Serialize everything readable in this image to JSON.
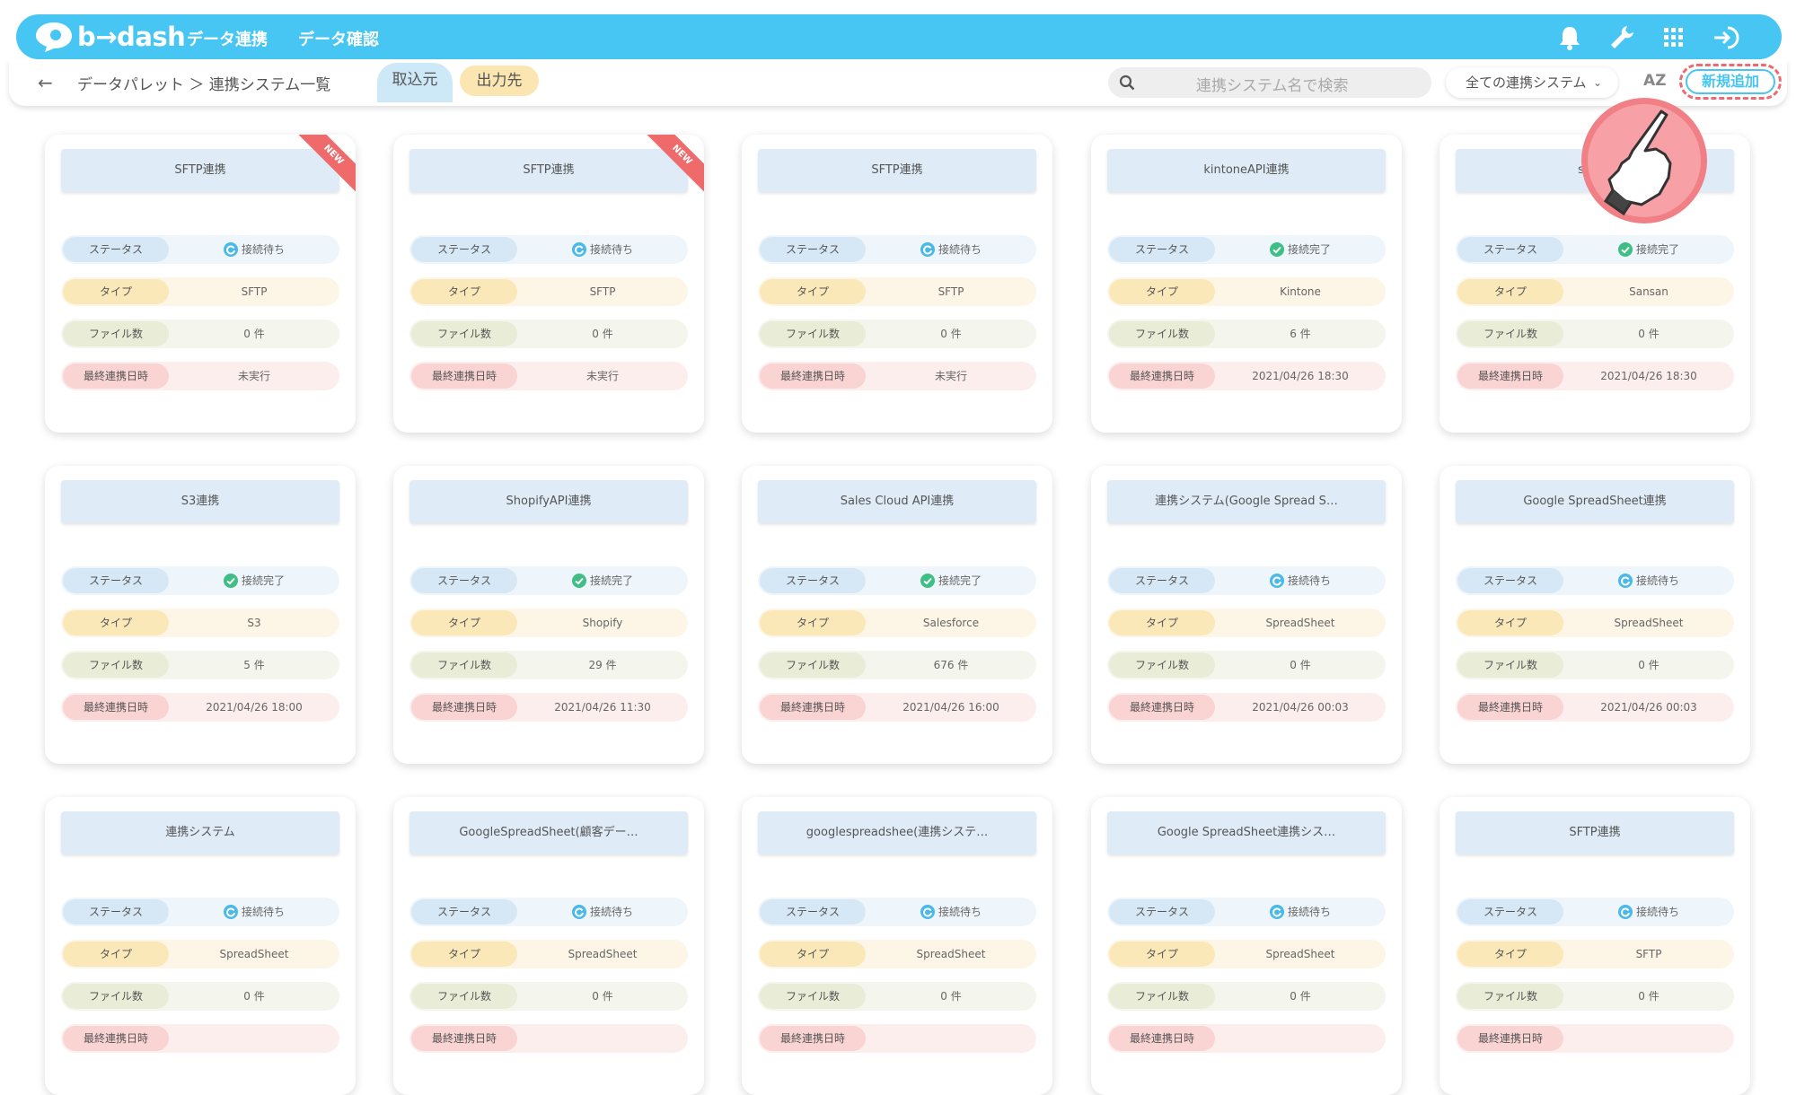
{
  "app": {
    "logo_text": "b→dash"
  },
  "nav": {
    "item1": "データ連携",
    "item2": "データ確認"
  },
  "breadcrumb": "データパレット ＞ 連携システム一覧",
  "tabs": {
    "import": "取込元",
    "export": "出力先"
  },
  "search": {
    "placeholder": "連携システム名で検索"
  },
  "filter": {
    "selected": "全ての連携システム"
  },
  "sort_label": "AZ",
  "new_button": "新規追加",
  "labels": {
    "status": "ステータス",
    "type": "タイプ",
    "files": "ファイル数",
    "last": "最終連携日時"
  },
  "badges": {
    "new": "NEW"
  },
  "colors": {
    "accent": "#48c6f3",
    "waiting": "#48b9e8",
    "done": "#3fbe85",
    "highlight": "#ee6a72"
  },
  "cards": [
    {
      "title": "SFTP連携",
      "status": "接続待ち",
      "status_kind": "waiting",
      "type": "SFTP",
      "files": "0 件",
      "last": "未実行",
      "is_new": true
    },
    {
      "title": "SFTP連携",
      "status": "接続待ち",
      "status_kind": "waiting",
      "type": "SFTP",
      "files": "0 件",
      "last": "未実行",
      "is_new": true
    },
    {
      "title": "SFTP連携",
      "status": "接続待ち",
      "status_kind": "waiting",
      "type": "SFTP",
      "files": "0 件",
      "last": "未実行",
      "is_new": false
    },
    {
      "title": "kintoneAPI連携",
      "status": "接続完了",
      "status_kind": "done",
      "type": "Kintone",
      "files": "6 件",
      "last": "2021/04/26 18:30",
      "is_new": false
    },
    {
      "title": "sansa",
      "status": "接続完了",
      "status_kind": "done",
      "type": "Sansan",
      "files": "0 件",
      "last": "2021/04/26 18:30",
      "is_new": false
    },
    {
      "title": "S3連携",
      "status": "接続完了",
      "status_kind": "done",
      "type": "S3",
      "files": "5 件",
      "last": "2021/04/26 18:00",
      "is_new": false
    },
    {
      "title": "ShopifyAPI連携",
      "status": "接続完了",
      "status_kind": "done",
      "type": "Shopify",
      "files": "29 件",
      "last": "2021/04/26 11:30",
      "is_new": false
    },
    {
      "title": "Sales Cloud API連携",
      "status": "接続完了",
      "status_kind": "done",
      "type": "Salesforce",
      "files": "676 件",
      "last": "2021/04/26 16:00",
      "is_new": false
    },
    {
      "title": "連携システム(Google Spread S…",
      "status": "接続待ち",
      "status_kind": "waiting",
      "type": "SpreadSheet",
      "files": "0 件",
      "last": "2021/04/26 00:03",
      "is_new": false
    },
    {
      "title": "Google SpreadSheet連携",
      "status": "接続待ち",
      "status_kind": "waiting",
      "type": "SpreadSheet",
      "files": "0 件",
      "last": "2021/04/26 00:03",
      "is_new": false
    },
    {
      "title": "連携システム",
      "status": "接続待ち",
      "status_kind": "waiting",
      "type": "SpreadSheet",
      "files": "0 件",
      "last": "",
      "is_new": false
    },
    {
      "title": "GoogleSpreadSheet(顧客デー…",
      "status": "接続待ち",
      "status_kind": "waiting",
      "type": "SpreadSheet",
      "files": "0 件",
      "last": "",
      "is_new": false
    },
    {
      "title": "googlespreadshee(連携システ…",
      "status": "接続待ち",
      "status_kind": "waiting",
      "type": "SpreadSheet",
      "files": "0 件",
      "last": "",
      "is_new": false
    },
    {
      "title": "Google SpreadSheet連携シス…",
      "status": "接続待ち",
      "status_kind": "waiting",
      "type": "SpreadSheet",
      "files": "0 件",
      "last": "",
      "is_new": false
    },
    {
      "title": "SFTP連携",
      "status": "接続待ち",
      "status_kind": "waiting",
      "type": "SFTP",
      "files": "0 件",
      "last": "",
      "is_new": false
    }
  ]
}
